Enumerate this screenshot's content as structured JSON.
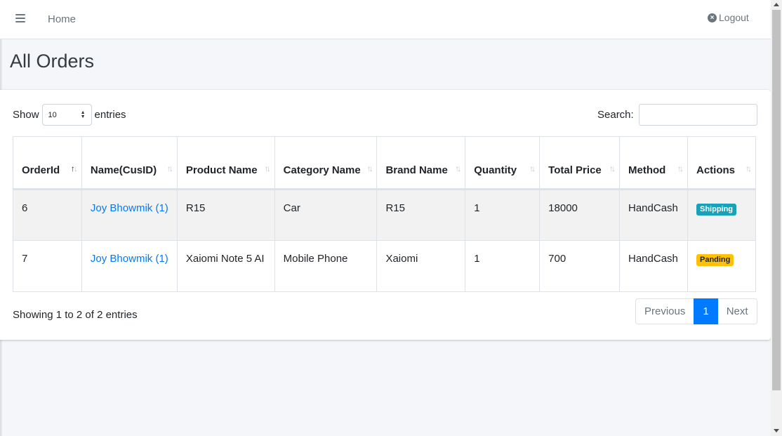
{
  "navbar": {
    "home_label": "Home",
    "logout_label": "Logout"
  },
  "page": {
    "title": "All Orders"
  },
  "table_controls": {
    "show_label": "Show",
    "entries_value": "10",
    "entries_label": "entries",
    "search_label": "Search:",
    "search_value": ""
  },
  "table": {
    "columns": [
      {
        "label": "OrderId",
        "sort": "asc"
      },
      {
        "label": "Name(CusID)",
        "sort": "none"
      },
      {
        "label": "Product Name",
        "sort": "none"
      },
      {
        "label": "Category Name",
        "sort": "none"
      },
      {
        "label": "Brand Name",
        "sort": "none"
      },
      {
        "label": "Quantity",
        "sort": "none"
      },
      {
        "label": "Total Price",
        "sort": "none"
      },
      {
        "label": "Method",
        "sort": "none"
      },
      {
        "label": "Actions",
        "sort": "none"
      }
    ],
    "rows": [
      {
        "order_id": "6",
        "name": "Joy Bhowmik (1)",
        "product": "R15",
        "category": "Car",
        "brand": "R15",
        "quantity": "1",
        "total": "18000",
        "method": "HandCash",
        "status": "Shipping"
      },
      {
        "order_id": "7",
        "name": "Joy Bhowmik (1)",
        "product": "Xaiomi Note 5 AI",
        "category": "Mobile Phone",
        "brand": "Xaiomi",
        "quantity": "1",
        "total": "700",
        "method": "HandCash",
        "status": "Panding"
      }
    ]
  },
  "footer": {
    "info": "Showing 1 to 2 of 2 entries",
    "prev_label": "Previous",
    "page_1": "1",
    "next_label": "Next"
  },
  "colors": {
    "link": "#007bff",
    "shipping_badge": "#17a2b8",
    "pending_badge": "#ffc107",
    "active_page": "#007bff"
  },
  "icons": {
    "menu": "hamburger-icon",
    "logout": "times-circle-icon",
    "sort": "sort-arrows-icon"
  }
}
